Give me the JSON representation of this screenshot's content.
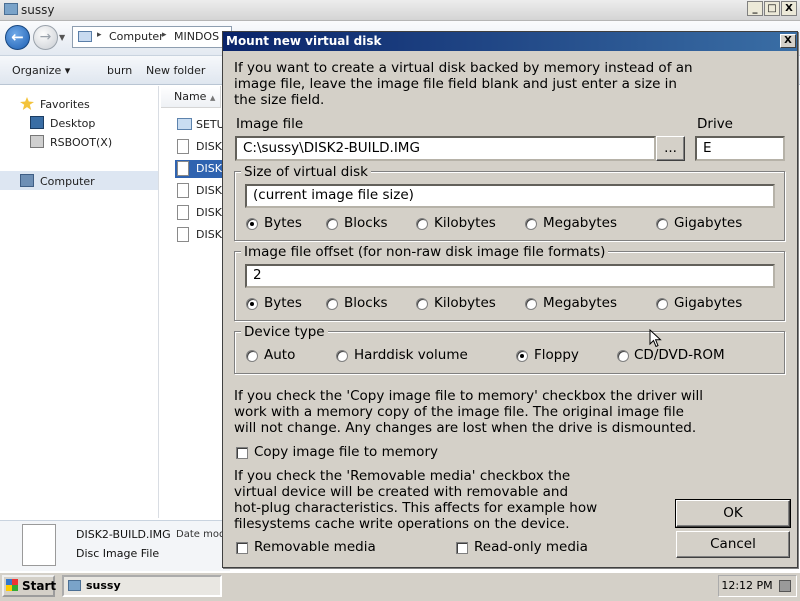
{
  "explorer": {
    "title": "sussy",
    "caption_buttons": {
      "minimize": "_",
      "maximize": "□",
      "close": "X"
    },
    "address": {
      "crumbs": [
        "Computer",
        "MINDOS ("
      ],
      "separators": [
        "▸",
        "▸"
      ]
    },
    "commands": {
      "organize": "Organize ▾",
      "burn": "burn",
      "new_folder": "New folder"
    },
    "nav": {
      "favorites": "Favorites",
      "desktop": "Desktop",
      "rsboot": "RSBOOT(X)",
      "computer": "Computer"
    },
    "column_header": "Name",
    "files": [
      "SETU",
      "DISK",
      "DISK",
      "DISK",
      "DISK",
      "DISK"
    ],
    "details": {
      "name": "DISK2-BUILD.IMG",
      "date_label": "Date mod",
      "type": "Disc Image File"
    }
  },
  "taskbar": {
    "start_label": "Start",
    "task_label": "sussy",
    "clock": "12:12 PM"
  },
  "dialog": {
    "title": "Mount new virtual disk",
    "close": "X",
    "intro": [
      "If you want to create a virtual disk backed by memory instead of an",
      "image file, leave the image file field blank and just enter a size in",
      "the size field."
    ],
    "image_file_label": "Image file",
    "image_file_value": "C:\\sussy\\DISK2-BUILD.IMG",
    "browse_label": "...",
    "drive_label": "Drive",
    "drive_value": "E",
    "size_group": {
      "legend": "Size of virtual disk",
      "value": "(current image file size)",
      "units": [
        "Bytes",
        "Blocks",
        "Kilobytes",
        "Megabytes",
        "Gigabytes"
      ],
      "selected": "Bytes"
    },
    "offset_group": {
      "legend": "Image file offset (for non-raw disk image file formats)",
      "value": "2",
      "units": [
        "Bytes",
        "Blocks",
        "Kilobytes",
        "Megabytes",
        "Gigabytes"
      ],
      "selected": "Bytes"
    },
    "device_group": {
      "legend": "Device type",
      "options": [
        "Auto",
        "Harddisk volume",
        "Floppy",
        "CD/DVD-ROM"
      ],
      "selected": "Floppy"
    },
    "copy_info": [
      "If you check the 'Copy image file to memory' checkbox the driver will",
      "work with a memory copy of the image file. The original image file",
      "will not change. Any changes are lost when the drive is dismounted."
    ],
    "copy_checkbox": {
      "label": "Copy image file to memory",
      "checked": false
    },
    "removable_info": [
      "If you check the 'Removable media' checkbox the",
      "virtual device will be created with removable and",
      "hot-plug characteristics. This affects for example how",
      "filesystems cache write operations on the device."
    ],
    "removable_checkbox": {
      "label": "Removable media",
      "checked": false
    },
    "readonly_checkbox": {
      "label": "Read-only media",
      "checked": false
    },
    "ok_label": "OK",
    "cancel_label": "Cancel"
  }
}
